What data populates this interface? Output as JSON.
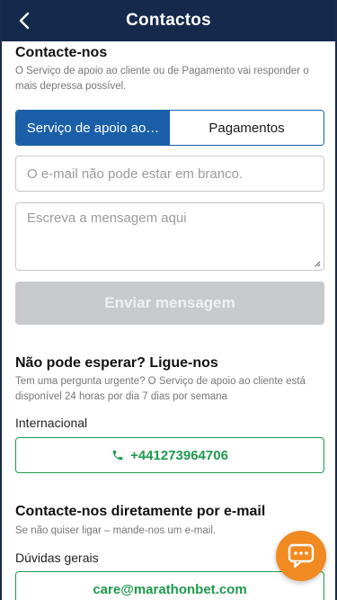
{
  "header": {
    "title": "Contactos"
  },
  "contact_form": {
    "title": "Contacte-nos",
    "subtitle": "O Serviço de apoio ao cliente ou de Pagamento vai responder o mais depressa possível.",
    "tabs": [
      {
        "label": "Serviço de apoio ao…",
        "active": true
      },
      {
        "label": "Pagamentos",
        "active": false
      }
    ],
    "email_placeholder": "O e-mail não pode estar em branco.",
    "message_placeholder": "Escreva a mensagem aqui",
    "send_label": "Enviar mensagem"
  },
  "phone_section": {
    "title": "Não pode esperar? Ligue-nos",
    "subtitle": "Tem uma pergunta urgente? O Serviço de apoio ao cliente está disponível 24 horas por dia 7 dias por semana",
    "international_label": "Internacional",
    "phone_number": "+441273964706"
  },
  "email_section": {
    "title": "Contacte-nos diretamente por e-mail",
    "subtitle": "Se não quiser ligar – mande-nos um e-mail.",
    "general_label": "Dúvidas gerais",
    "email": "care@marathonbet.com"
  },
  "colors": {
    "header_bg": "#15294b",
    "accent_blue": "#1a5fa8",
    "green": "#1f9a4c",
    "chat_orange": "#f08a21",
    "disabled_button": "#c7c9cc"
  },
  "icons": [
    "back-arrow-icon",
    "phone-icon",
    "chat-bubble-icon"
  ]
}
